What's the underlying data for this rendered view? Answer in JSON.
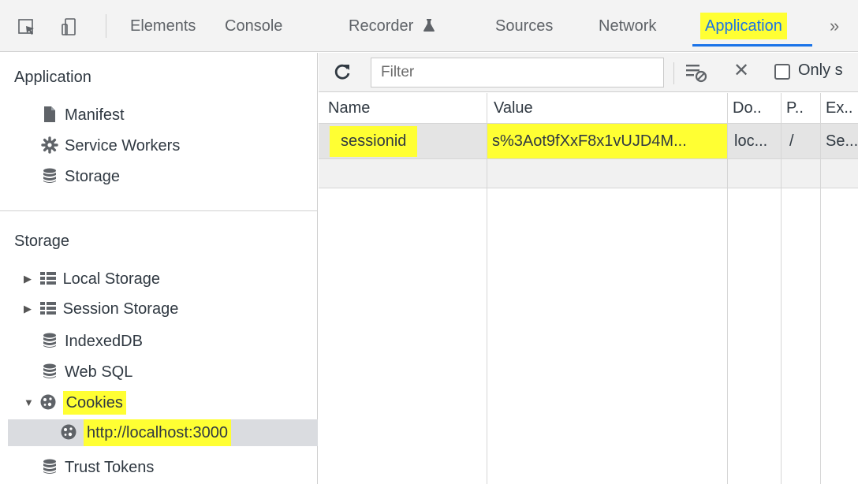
{
  "tabs": [
    {
      "label": "Elements"
    },
    {
      "label": "Console"
    },
    {
      "label": "Recorder"
    },
    {
      "label": "Sources"
    },
    {
      "label": "Network"
    },
    {
      "label": "Application"
    }
  ],
  "more_label": "»",
  "sidebar": {
    "application_heading": "Application",
    "application_items": [
      {
        "label": "Manifest",
        "icon": "file-icon"
      },
      {
        "label": "Service Workers",
        "icon": "gear-icon"
      },
      {
        "label": "Storage",
        "icon": "database-icon"
      }
    ],
    "storage_heading": "Storage",
    "storage_items": [
      {
        "label": "Local Storage",
        "icon": "grid-icon"
      },
      {
        "label": "Session Storage",
        "icon": "grid-icon"
      },
      {
        "label": "IndexedDB",
        "icon": "database-icon"
      },
      {
        "label": "Web SQL",
        "icon": "database-icon"
      },
      {
        "label": "Cookies",
        "icon": "cookie-icon"
      },
      {
        "label": "http://localhost:3000",
        "icon": "cookie-icon"
      },
      {
        "label": "Trust Tokens",
        "icon": "database-icon"
      }
    ]
  },
  "toolbar": {
    "filter_placeholder": "Filter",
    "only_label": "Only s"
  },
  "table": {
    "headers": [
      "Name",
      "Value",
      "Do..",
      "P..",
      "Ex.."
    ],
    "rows": [
      {
        "name": "sessionid",
        "value": "s%3Aot9fXxF8x1vUJD4M...",
        "domain": "loc...",
        "path": "/",
        "expires": "Se..."
      }
    ]
  },
  "colors": {
    "highlight": "#ffff33",
    "accent": "#1a73e8"
  }
}
